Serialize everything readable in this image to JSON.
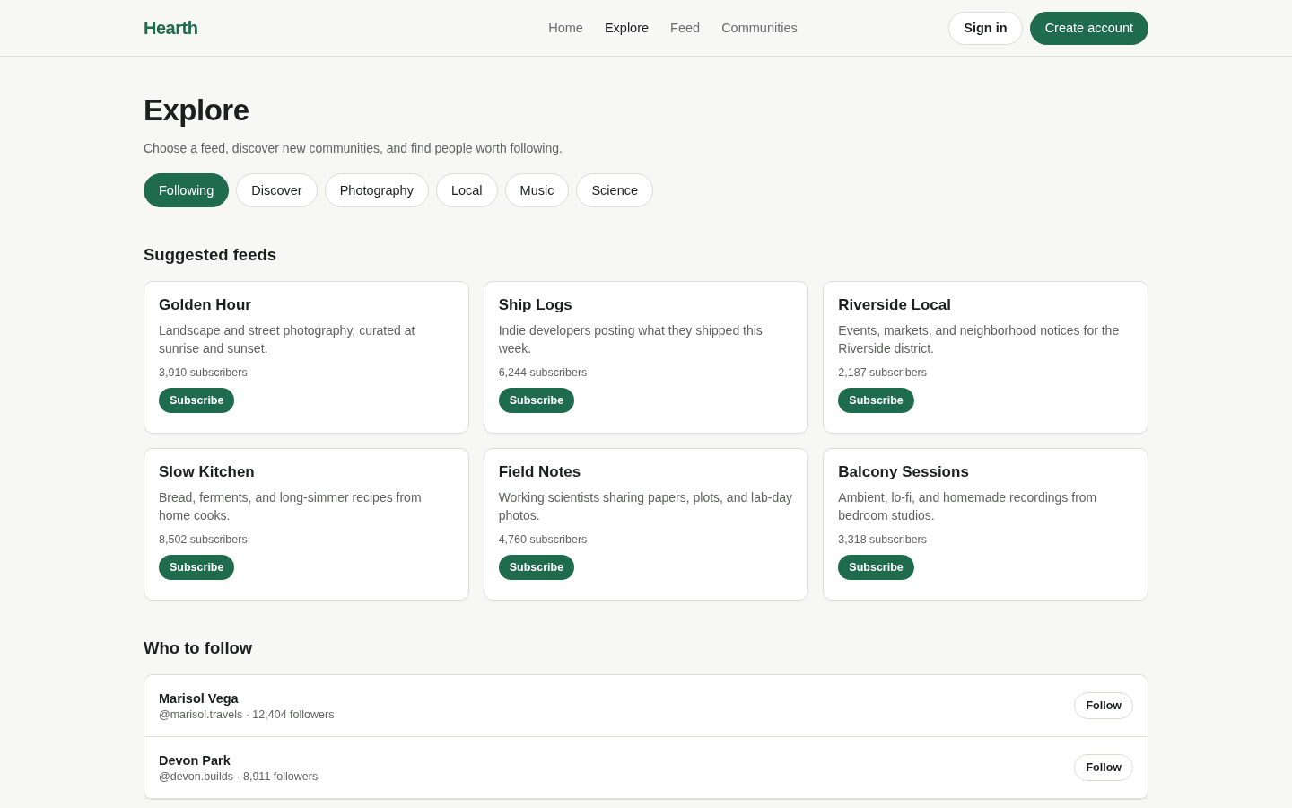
{
  "brand": "Hearth",
  "nav": [
    {
      "label": "Home",
      "selected": false
    },
    {
      "label": "Explore",
      "selected": true
    },
    {
      "label": "Feed",
      "selected": false
    },
    {
      "label": "Communities",
      "selected": false
    }
  ],
  "auth": {
    "sign_in": "Sign in",
    "create_account": "Create account"
  },
  "page": {
    "title": "Explore",
    "subtitle": "Choose a feed, discover new communities, and find people worth following."
  },
  "filters": [
    {
      "label": "Following",
      "selected": true
    },
    {
      "label": "Discover",
      "selected": false
    },
    {
      "label": "Photography",
      "selected": false
    },
    {
      "label": "Local",
      "selected": false
    },
    {
      "label": "Music",
      "selected": false
    },
    {
      "label": "Science",
      "selected": false
    }
  ],
  "suggested_feeds": {
    "heading": "Suggested feeds",
    "feeds": [
      {
        "name": "Golden Hour",
        "description": "Landscape and street photography, curated at sunrise and sunset.",
        "subscribers": "3,910 subscribers",
        "action": "Subscribe"
      },
      {
        "name": "Ship Logs",
        "description": "Indie developers posting what they shipped this week.",
        "subscribers": "6,244 subscribers",
        "action": "Subscribe"
      },
      {
        "name": "Riverside Local",
        "description": "Events, markets, and neighborhood notices for the Riverside district.",
        "subscribers": "2,187 subscribers",
        "action": "Subscribe"
      },
      {
        "name": "Slow Kitchen",
        "description": "Bread, ferments, and long-simmer recipes from home cooks.",
        "subscribers": "8,502 subscribers",
        "action": "Subscribe"
      },
      {
        "name": "Field Notes",
        "description": "Working scientists sharing papers, plots, and lab-day photos.",
        "subscribers": "4,760 subscribers",
        "action": "Subscribe"
      },
      {
        "name": "Balcony Sessions",
        "description": "Ambient, lo-fi, and homemade recordings from bedroom studios.",
        "subscribers": "3,318 subscribers",
        "action": "Subscribe"
      }
    ]
  },
  "who_to_follow": {
    "heading": "Who to follow",
    "people": [
      {
        "name": "Marisol Vega",
        "meta": "@marisol.travels · 12,404 followers",
        "action": "Follow"
      },
      {
        "name": "Devon Park",
        "meta": "@devon.builds · 8,911 followers",
        "action": "Follow"
      }
    ]
  }
}
